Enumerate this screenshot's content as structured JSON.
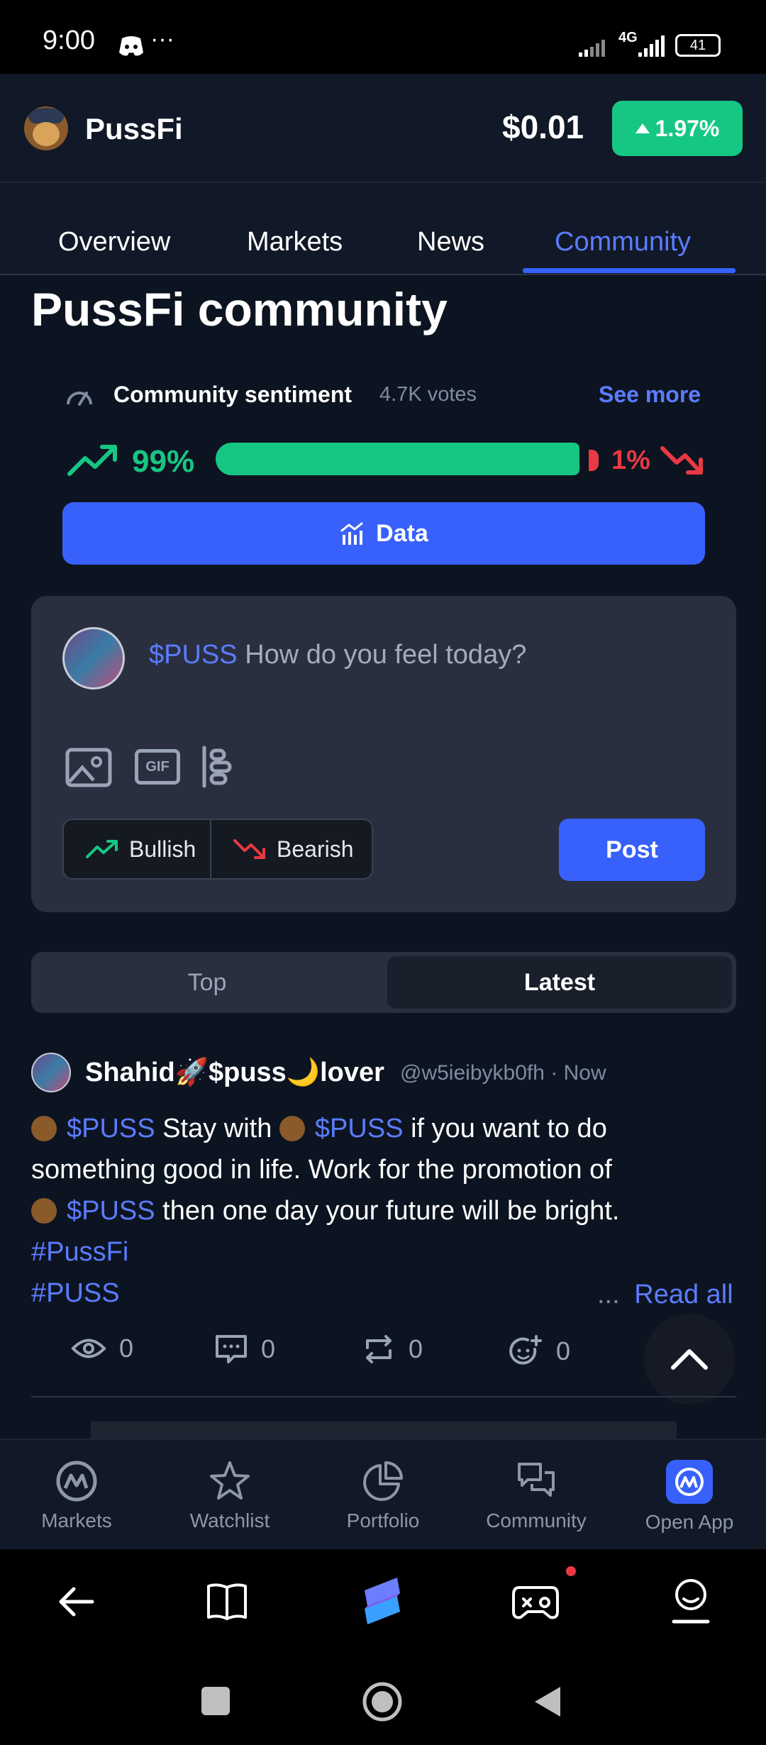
{
  "status_bar": {
    "time": "9:00",
    "more": "···",
    "network": "4G",
    "battery": "41"
  },
  "header": {
    "title": "PussFi",
    "price": "$0.01",
    "change": "1.97%"
  },
  "tabs": [
    {
      "label": "Overview"
    },
    {
      "label": "Markets"
    },
    {
      "label": "News"
    },
    {
      "label": "Community",
      "active": true
    }
  ],
  "page_title": "PussFi community",
  "sentiment": {
    "label": "Community sentiment",
    "votes": "4.7K votes",
    "see_more": "See more",
    "bullish_pct": "99%",
    "bearish_pct": "1%",
    "bullish_fraction": 0.99
  },
  "data_button": "Data",
  "composer": {
    "ticker": "$PUSS",
    "placeholder": "How do you feel today?",
    "gif_label": "GIF",
    "bullish": "Bullish",
    "bearish": "Bearish",
    "post": "Post"
  },
  "sort": {
    "top": "Top",
    "latest": "Latest",
    "selected": "Latest"
  },
  "post": {
    "author": "Shahid🚀$puss🌙lover",
    "handle": "@w5ieibykb0fh",
    "sep": "·",
    "time": "Now",
    "line1_ticker": "$PUSS",
    "line1_text": " Stay with ",
    "line1_ticker2": "$PUSS",
    "line1_text2": " if you want to do",
    "line2_text": "something good in life. Work for the promotion of",
    "line3_ticker": "$PUSS",
    "line3_text": " then one day your future will be bright.",
    "hashtag1": "#PussFi",
    "hashtag2": "#PUSS",
    "ellipsis": "...",
    "read_all": "Read all",
    "views": "0",
    "comments": "0",
    "reposts": "0",
    "reactions": "0"
  },
  "bottom_nav": [
    {
      "label": "Markets"
    },
    {
      "label": "Watchlist"
    },
    {
      "label": "Portfolio"
    },
    {
      "label": "Community"
    },
    {
      "label": "Open App"
    }
  ],
  "colors": {
    "accent": "#3861fb",
    "bullish": "#16c784",
    "bearish": "#ea3943",
    "background": "#0d1421"
  }
}
